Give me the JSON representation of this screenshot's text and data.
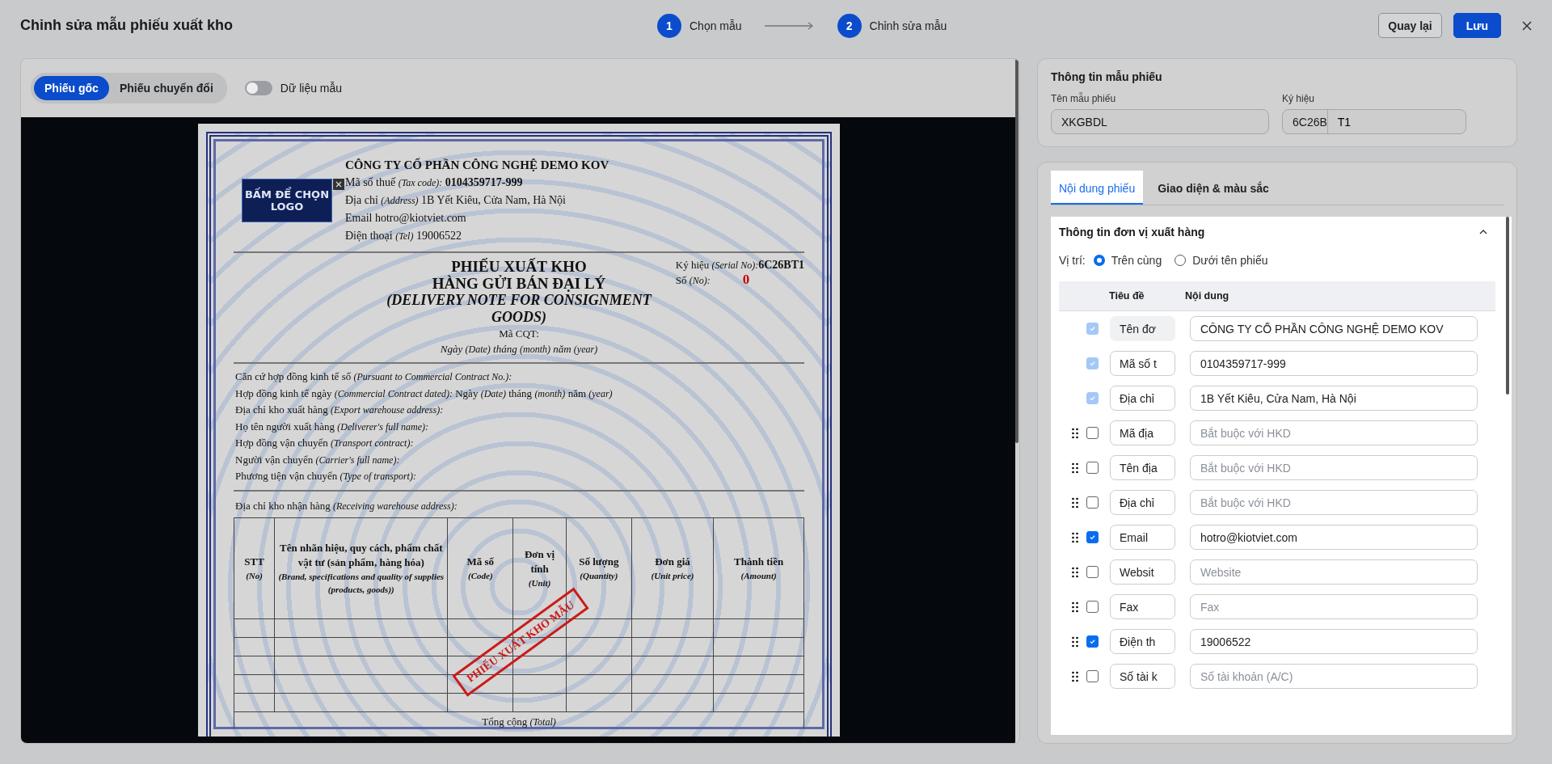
{
  "header": {
    "title": "Chỉnh sửa mẫu phiếu xuất kho",
    "steps": [
      {
        "number": "1",
        "label": "Chọn mẫu"
      },
      {
        "number": "2",
        "label": "Chỉnh sửa mẫu"
      }
    ],
    "buttons": [
      {
        "label": "Quay lại",
        "kind": "secondary"
      },
      {
        "label": "Lưu",
        "kind": "primary"
      }
    ]
  },
  "preview": {
    "view_tabs": [
      {
        "label": "Phiếu gốc",
        "selected": true
      },
      {
        "label": "Phiếu chuyển đổi",
        "selected": false
      }
    ],
    "sample_toggle": {
      "label": "Dữ liệu mẫu",
      "on": false
    },
    "document": {
      "logo": "BẤM ĐỂ CHỌN LOGO",
      "company": {
        "name": "CÔNG TY CỔ PHẦN CÔNG NGHỆ DEMO KOV",
        "lines": [
          "Mã số thuế *(Tax code):* **0104359717-999**",
          "Địa chỉ  *(Address)* 1B Yết Kiêu, Cửa Nam, Hà Nội",
          "Email hotro@kiotviet.com",
          "Điện thoại  *(Tel)* 19006522"
        ]
      },
      "title_lines": [
        "PHIẾU XUẤT KHO",
        "HÀNG GỬI BÁN ĐẠI LÝ"
      ],
      "subtitle": "(DELIVERY NOTE FOR CONSIGNMENT GOODS)",
      "tax_authority_code": "Mã CQT:",
      "date_line": "Ngày *(Date)*  tháng *(month)*  năm *(year)*",
      "serial": {
        "label": "Ký hiệu  *(Serial No):*",
        "value": "6C26BT1"
      },
      "number": {
        "label": "Số  *(No):*",
        "value": "0"
      },
      "fields": [
        "Căn cứ hợp đồng kinh tế số  *(Pursuant to Commercial Contract No.):*",
        "Hợp đồng kinh tế ngày  *(Commercial Contract dated):* Ngày *(Date)*  tháng *(month)*  năm *(year)*",
        "Địa chỉ kho xuất hàng  *(Export warehouse address):*",
        "Họ tên người xuất hàng  *(Deliverer's full name):*",
        "Hợp đồng vận chuyển  *(Transport contract):*",
        "Người vận chuyển  *(Carrier's full name):*",
        "Phương tiện vận chuyển  *(Type of transport):*"
      ],
      "receiving": "Địa chỉ kho nhận hàng  *(Receiving warehouse address):*",
      "columns": [
        {
          "title": "STT",
          "subtitle": "(No)"
        },
        {
          "title": "Tên nhãn hiệu, quy cách, phẩm chất vật tư (sản phẩm, hàng hóa)",
          "subtitle": "(Brand, specifications and quality of supplies (products, goods))"
        },
        {
          "title": "Mã số",
          "subtitle": "(Code)"
        },
        {
          "title": "Đơn vị tính",
          "subtitle": "(Unit)"
        },
        {
          "title": "Số lượng",
          "subtitle": "(Quantity)"
        },
        {
          "title": "Đơn giá",
          "subtitle": "(Unit price)"
        },
        {
          "title": "Thành tiền",
          "subtitle": "(Amount)"
        }
      ],
      "total": "Tổng cộng *(Total)*",
      "stamp": "PHIẾU XUẤT KHO MẪU"
    }
  },
  "template_info": {
    "title": "Thông tin mẫu phiếu",
    "name_label": "Tên mẫu phiếu",
    "name_value": "XKGBDL",
    "symbol_label": "Ký hiệu",
    "symbol_prefix": "6C26B",
    "symbol_suffix": "T1"
  },
  "settings": {
    "tabs": [
      {
        "label": "Nội dung phiếu",
        "selected": true
      },
      {
        "label": "Giao diện & màu sắc",
        "selected": false
      }
    ],
    "section": {
      "title": "Thông tin đơn vị xuất hàng",
      "expanded": true,
      "position_label": "Vị trí:",
      "positions": [
        {
          "label": "Trên cùng",
          "selected": true
        },
        {
          "label": "Dưới tên phiếu",
          "selected": false
        }
      ],
      "columns": [
        "Tiêu đề",
        "Nội dung"
      ],
      "rows": [
        {
          "title": "Tên đơ",
          "value": "CÔNG TY CỔ PHẦN CÔNG NGHỆ DEMO KOV",
          "checked": true,
          "locked": true,
          "title_disabled": true
        },
        {
          "title": "Mã số t",
          "value": "0104359717-999",
          "checked": true,
          "locked": true,
          "title_disabled": false
        },
        {
          "title": "Địa chỉ",
          "value": "1B Yết Kiêu, Cửa Nam, Hà Nội",
          "checked": true,
          "locked": true,
          "title_disabled": false
        },
        {
          "title": "Mã địa",
          "placeholder": "Bắt buộc với HKD",
          "checked": false,
          "locked": false,
          "title_disabled": false
        },
        {
          "title": "Tên địa",
          "placeholder": "Bắt buộc với HKD",
          "checked": false,
          "locked": false,
          "title_disabled": false
        },
        {
          "title": "Địa chỉ",
          "placeholder": "Bắt buộc với HKD",
          "checked": false,
          "locked": false,
          "title_disabled": false
        },
        {
          "title": "Email",
          "value": "hotro@kiotviet.com",
          "checked": true,
          "locked": false,
          "title_disabled": false
        },
        {
          "title": "Websit",
          "placeholder": "Website",
          "checked": false,
          "locked": false,
          "title_disabled": false
        },
        {
          "title": "Fax",
          "placeholder": "Fax",
          "checked": false,
          "locked": false,
          "title_disabled": false
        },
        {
          "title": "Điện th",
          "value": "19006522",
          "checked": true,
          "locked": false,
          "title_disabled": false
        },
        {
          "title": "Số tài k",
          "placeholder": "Số tài khoản (A/C)",
          "checked": false,
          "locked": false,
          "title_disabled": false
        }
      ]
    }
  }
}
